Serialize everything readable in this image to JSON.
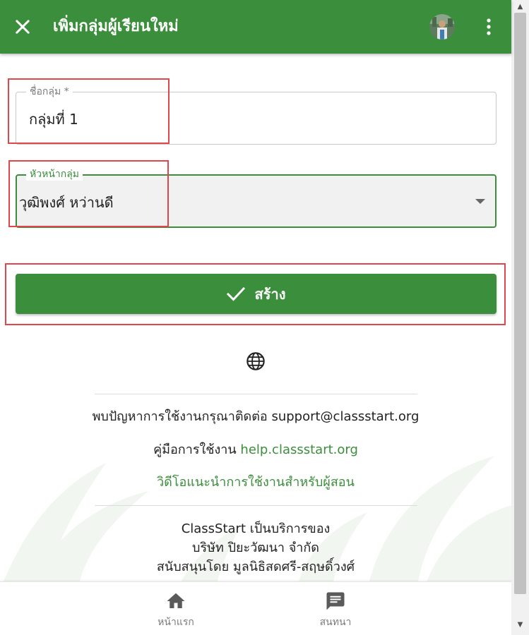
{
  "appbar": {
    "title": "เพิ่มกลุ่มผู้เรียนใหม่",
    "background": "#3b8e3b"
  },
  "form": {
    "name_field": {
      "label": "ชื่อกลุ่ม *",
      "value": "กลุ่มที่ 1"
    },
    "head_field": {
      "label": "หัวหน้ากลุ่ม",
      "value": "วุฒิพงศ์ หว่านดี"
    },
    "create_button": {
      "label": "สร้าง"
    }
  },
  "footer": {
    "support_prefix": "พบปัญหาการใช้งานกรุณาติดต่อ ",
    "support_email": "support@classstart.org",
    "manual_prefix": "คู่มือการใช้งาน ",
    "manual_link": "help.classstart.org",
    "video_link": "วิดีโอแนะนำการใช้งานสำหรับผู้สอน",
    "service_line": "ClassStart เป็นบริการของ",
    "company_line": "บริษัท ปิยะวัฒนา จำกัด",
    "sponsor_line": "สนับสนุนโดย มูลนิธิสดศรี-สฤษดิ์วงศ์"
  },
  "bottom_nav": {
    "home_label": "หน้าแรก",
    "chat_label": "สนทนา"
  },
  "colors": {
    "primary": "#3b8e3b",
    "highlight": "#e0474c",
    "label_gray": "#7a7a7a"
  },
  "icons": [
    "close-icon",
    "avatar",
    "more-vert-icon",
    "dropdown-arrow-icon",
    "check-icon",
    "globe-icon",
    "home-icon",
    "chat-icon"
  ]
}
